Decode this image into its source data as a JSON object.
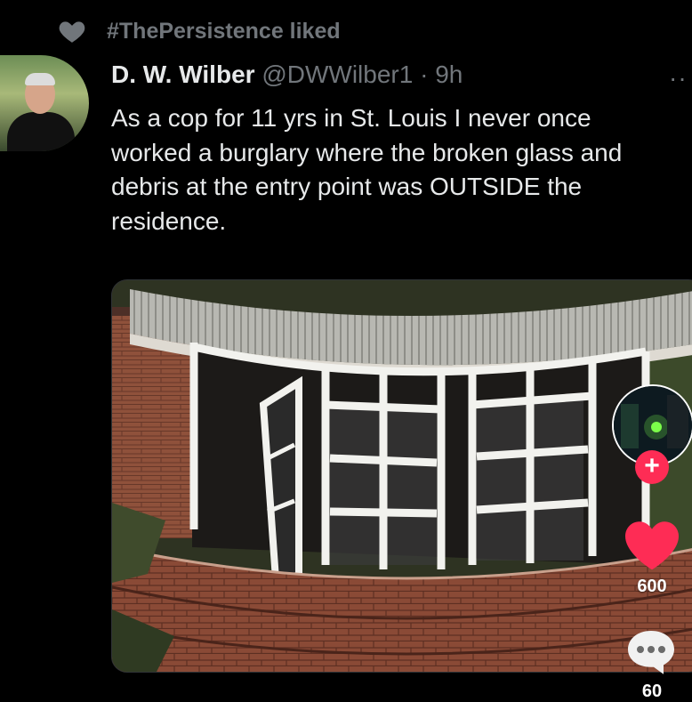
{
  "social_context": {
    "liked_text": "#ThePersistence liked",
    "icon": "heart-icon"
  },
  "tweet": {
    "author_name": "D. W. Wilber",
    "handle": "@DWWilber1",
    "separator": "·",
    "time": "9h",
    "more_icon": "more-icon",
    "text_lines": [
      "As a cop for 11 yrs in St. Louis I never once",
      "worked a burglary where the broken glass and",
      "debris at the entry point was OUTSIDE the",
      "residence."
    ]
  },
  "video_overlay": {
    "follow_label": "+",
    "like_count": "600",
    "comment_count": "60",
    "like_color": "#fe2c55"
  }
}
